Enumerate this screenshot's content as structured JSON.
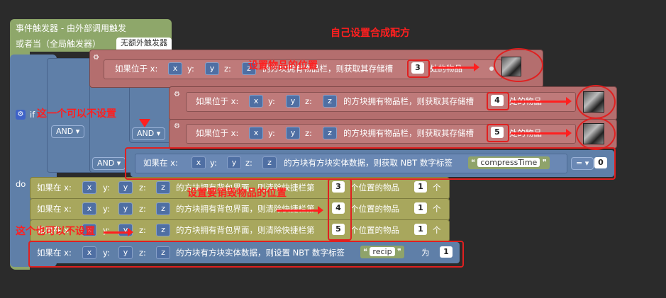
{
  "trigger": {
    "title": "事件触发器 - 由外部调用触发",
    "or_when": "或者当（全局触发器）",
    "trigger_pill": "无额外触发器"
  },
  "logic": {
    "if_label": "if",
    "do_label": "do",
    "and_label": "AND"
  },
  "cond_rows": [
    {
      "prefix": "如果位于 x:",
      "x": "x",
      "y_label": "y:",
      "y": "y",
      "z_label": "z:",
      "z": "z",
      "mid": "的方块拥有物品栏，则获取其存储槽",
      "slot": "3",
      "suffix": "处的物品"
    },
    {
      "prefix": "如果位于 x:",
      "x": "x",
      "y_label": "y:",
      "y": "y",
      "z_label": "z:",
      "z": "z",
      "mid": "的方块拥有物品栏，则获取其存储槽",
      "slot": "4",
      "suffix": "处的物品"
    },
    {
      "prefix": "如果位于 x:",
      "x": "x",
      "y_label": "y:",
      "y": "y",
      "z_label": "z:",
      "z": "z",
      "mid": "的方块拥有物品栏，则获取其存储槽",
      "slot": "5",
      "suffix": "处的物品"
    }
  ],
  "nbt_cond": {
    "prefix": "如果在 x:",
    "x": "x",
    "y_label": "y:",
    "y": "y",
    "z_label": "z:",
    "z": "z",
    "mid": "的方块有方块实体数据，则获取 NBT 数字标签",
    "tag": "compressTime",
    "op": "=",
    "value": "0"
  },
  "do_rows": [
    {
      "prefix": "如果在 x:",
      "x": "x",
      "y_label": "y:",
      "y": "y",
      "z_label": "z:",
      "z": "z",
      "mid": "的方块拥有背包界面，则清除快捷栏第",
      "slot": "3",
      "after": "个位置的物品",
      "count": "1",
      "unit": "个"
    },
    {
      "prefix": "如果在 x:",
      "x": "x",
      "y_label": "y:",
      "y": "y",
      "z_label": "z:",
      "z": "z",
      "mid": "的方块拥有背包界面，则清除快捷栏第",
      "slot": "4",
      "after": "个位置的物品",
      "count": "1",
      "unit": "个"
    },
    {
      "prefix": "如果在 x:",
      "x": "x",
      "y_label": "y:",
      "y": "y",
      "z_label": "z:",
      "z": "z",
      "mid": "的方块拥有背包界面，则清除快捷栏第",
      "slot": "5",
      "after": "个位置的物品",
      "count": "1",
      "unit": "个"
    }
  ],
  "nbt_set": {
    "prefix": "如果在 x:",
    "x": "x",
    "y_label": "y:",
    "y": "y",
    "z_label": "z:",
    "z": "z",
    "mid": "的方块有方块实体数据，则设置 NBT 数字标签",
    "tag": "recip",
    "as": "为",
    "value": "1"
  },
  "annotations": {
    "top": "自己设置合成配方",
    "set_items": "设置物品的位置",
    "optional1": "这一个可以不设置",
    "consume": "设置要销毁物品的位置",
    "optional2": "这个也可以不设置"
  },
  "colors": {
    "annotation": "#ff1f1f",
    "condition_block": "#b46e6e",
    "action_block": "#a8a75d",
    "logic_block": "#5f7fa8",
    "trigger_block": "#8ea76a"
  }
}
